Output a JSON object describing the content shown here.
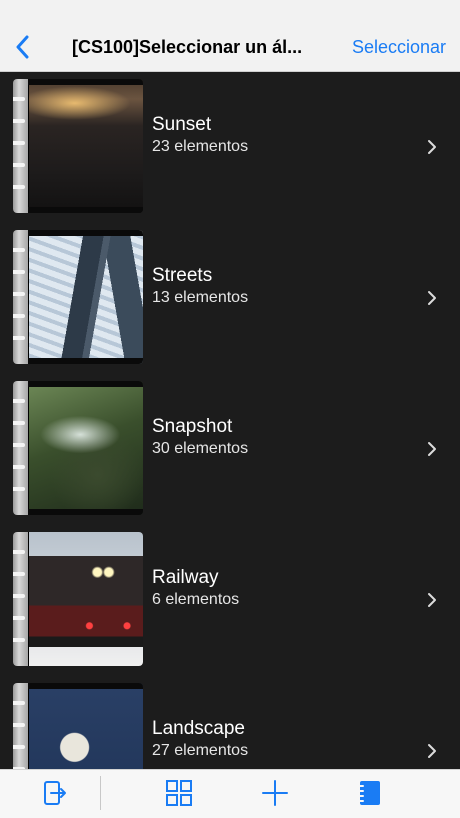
{
  "nav": {
    "title": "[CS100]Seleccionar un ál...",
    "select_label": "Seleccionar"
  },
  "albums": [
    {
      "name": "Sunset",
      "count": "23 elementos"
    },
    {
      "name": "Streets",
      "count": "13 elementos"
    },
    {
      "name": "Snapshot",
      "count": "30 elementos"
    },
    {
      "name": "Railway",
      "count": "6 elementos"
    },
    {
      "name": "Landscape",
      "count": "27 elementos"
    }
  ],
  "icons": {
    "back": "chevron-left-icon",
    "row_disclosure": "chevron-right-icon",
    "toolbar": [
      "export-icon",
      "grid-icon",
      "add-icon",
      "album-book-icon"
    ]
  },
  "colors": {
    "accent": "#1a7cf4",
    "list_background": "#1c1c1c",
    "nav_background": "#f2f2f2"
  }
}
